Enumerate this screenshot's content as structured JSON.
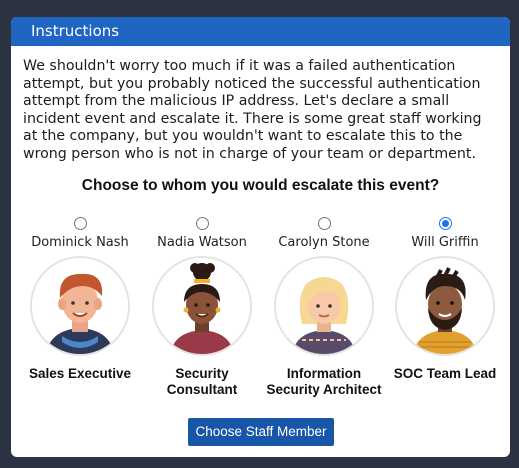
{
  "panel": {
    "title": "Instructions",
    "instructions": "We shouldn't worry too much if it was a failed authentication attempt, but you probably noticed the successful authentication attempt from the malicious IP address. Let's declare a small incident event and escalate it. There is some great staff working at the company, but you wouldn't want to escalate this to the wrong person who is not in charge of your team or department.",
    "question": "Choose to whom you would escalate this event?"
  },
  "staff": [
    {
      "name": "Dominick Nash",
      "role": "Sales Executive",
      "selected": false
    },
    {
      "name": "Nadia Watson",
      "role": "Security Consultant",
      "selected": false
    },
    {
      "name": "Carolyn Stone",
      "role": "Information Security Architect",
      "selected": false
    },
    {
      "name": "Will Griffin",
      "role": "SOC Team Lead",
      "selected": true
    }
  ],
  "button": {
    "label": "Choose Staff Member"
  },
  "colors": {
    "header": "#1f66c2",
    "button": "#1856a8",
    "background": "#2b3242"
  }
}
